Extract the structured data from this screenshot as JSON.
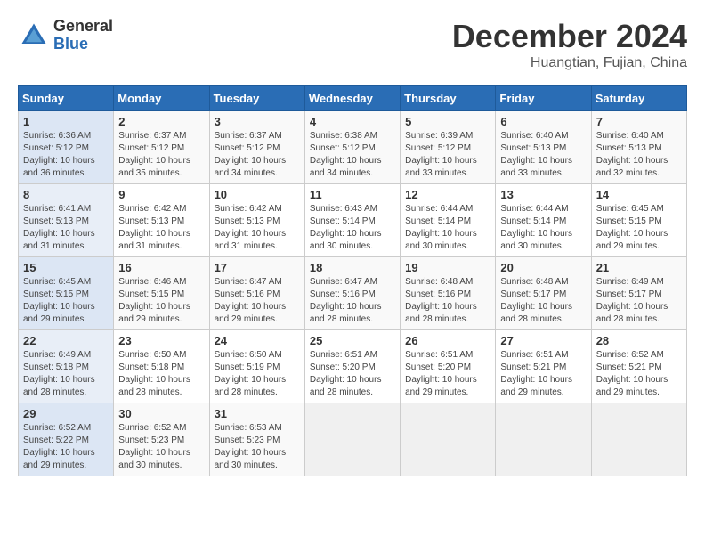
{
  "logo": {
    "general": "General",
    "blue": "Blue"
  },
  "title": "December 2024",
  "subtitle": "Huangtian, Fujian, China",
  "weekdays": [
    "Sunday",
    "Monday",
    "Tuesday",
    "Wednesday",
    "Thursday",
    "Friday",
    "Saturday"
  ],
  "weeks": [
    [
      {
        "day": "1",
        "info": "Sunrise: 6:36 AM\nSunset: 5:12 PM\nDaylight: 10 hours\nand 36 minutes."
      },
      {
        "day": "2",
        "info": "Sunrise: 6:37 AM\nSunset: 5:12 PM\nDaylight: 10 hours\nand 35 minutes."
      },
      {
        "day": "3",
        "info": "Sunrise: 6:37 AM\nSunset: 5:12 PM\nDaylight: 10 hours\nand 34 minutes."
      },
      {
        "day": "4",
        "info": "Sunrise: 6:38 AM\nSunset: 5:12 PM\nDaylight: 10 hours\nand 34 minutes."
      },
      {
        "day": "5",
        "info": "Sunrise: 6:39 AM\nSunset: 5:12 PM\nDaylight: 10 hours\nand 33 minutes."
      },
      {
        "day": "6",
        "info": "Sunrise: 6:40 AM\nSunset: 5:13 PM\nDaylight: 10 hours\nand 33 minutes."
      },
      {
        "day": "7",
        "info": "Sunrise: 6:40 AM\nSunset: 5:13 PM\nDaylight: 10 hours\nand 32 minutes."
      }
    ],
    [
      {
        "day": "8",
        "info": "Sunrise: 6:41 AM\nSunset: 5:13 PM\nDaylight: 10 hours\nand 31 minutes."
      },
      {
        "day": "9",
        "info": "Sunrise: 6:42 AM\nSunset: 5:13 PM\nDaylight: 10 hours\nand 31 minutes."
      },
      {
        "day": "10",
        "info": "Sunrise: 6:42 AM\nSunset: 5:13 PM\nDaylight: 10 hours\nand 31 minutes."
      },
      {
        "day": "11",
        "info": "Sunrise: 6:43 AM\nSunset: 5:14 PM\nDaylight: 10 hours\nand 30 minutes."
      },
      {
        "day": "12",
        "info": "Sunrise: 6:44 AM\nSunset: 5:14 PM\nDaylight: 10 hours\nand 30 minutes."
      },
      {
        "day": "13",
        "info": "Sunrise: 6:44 AM\nSunset: 5:14 PM\nDaylight: 10 hours\nand 30 minutes."
      },
      {
        "day": "14",
        "info": "Sunrise: 6:45 AM\nSunset: 5:15 PM\nDaylight: 10 hours\nand 29 minutes."
      }
    ],
    [
      {
        "day": "15",
        "info": "Sunrise: 6:45 AM\nSunset: 5:15 PM\nDaylight: 10 hours\nand 29 minutes."
      },
      {
        "day": "16",
        "info": "Sunrise: 6:46 AM\nSunset: 5:15 PM\nDaylight: 10 hours\nand 29 minutes."
      },
      {
        "day": "17",
        "info": "Sunrise: 6:47 AM\nSunset: 5:16 PM\nDaylight: 10 hours\nand 29 minutes."
      },
      {
        "day": "18",
        "info": "Sunrise: 6:47 AM\nSunset: 5:16 PM\nDaylight: 10 hours\nand 28 minutes."
      },
      {
        "day": "19",
        "info": "Sunrise: 6:48 AM\nSunset: 5:16 PM\nDaylight: 10 hours\nand 28 minutes."
      },
      {
        "day": "20",
        "info": "Sunrise: 6:48 AM\nSunset: 5:17 PM\nDaylight: 10 hours\nand 28 minutes."
      },
      {
        "day": "21",
        "info": "Sunrise: 6:49 AM\nSunset: 5:17 PM\nDaylight: 10 hours\nand 28 minutes."
      }
    ],
    [
      {
        "day": "22",
        "info": "Sunrise: 6:49 AM\nSunset: 5:18 PM\nDaylight: 10 hours\nand 28 minutes."
      },
      {
        "day": "23",
        "info": "Sunrise: 6:50 AM\nSunset: 5:18 PM\nDaylight: 10 hours\nand 28 minutes."
      },
      {
        "day": "24",
        "info": "Sunrise: 6:50 AM\nSunset: 5:19 PM\nDaylight: 10 hours\nand 28 minutes."
      },
      {
        "day": "25",
        "info": "Sunrise: 6:51 AM\nSunset: 5:20 PM\nDaylight: 10 hours\nand 28 minutes."
      },
      {
        "day": "26",
        "info": "Sunrise: 6:51 AM\nSunset: 5:20 PM\nDaylight: 10 hours\nand 29 minutes."
      },
      {
        "day": "27",
        "info": "Sunrise: 6:51 AM\nSunset: 5:21 PM\nDaylight: 10 hours\nand 29 minutes."
      },
      {
        "day": "28",
        "info": "Sunrise: 6:52 AM\nSunset: 5:21 PM\nDaylight: 10 hours\nand 29 minutes."
      }
    ],
    [
      {
        "day": "29",
        "info": "Sunrise: 6:52 AM\nSunset: 5:22 PM\nDaylight: 10 hours\nand 29 minutes."
      },
      {
        "day": "30",
        "info": "Sunrise: 6:52 AM\nSunset: 5:23 PM\nDaylight: 10 hours\nand 30 minutes."
      },
      {
        "day": "31",
        "info": "Sunrise: 6:53 AM\nSunset: 5:23 PM\nDaylight: 10 hours\nand 30 minutes."
      },
      {
        "day": "",
        "info": ""
      },
      {
        "day": "",
        "info": ""
      },
      {
        "day": "",
        "info": ""
      },
      {
        "day": "",
        "info": ""
      }
    ]
  ]
}
